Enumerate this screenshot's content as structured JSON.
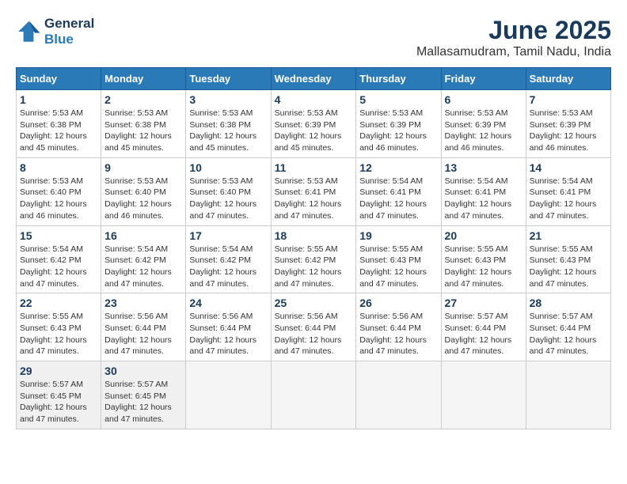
{
  "header": {
    "logo_line1": "General",
    "logo_line2": "Blue",
    "month": "June 2025",
    "location": "Mallasamudram, Tamil Nadu, India"
  },
  "weekdays": [
    "Sunday",
    "Monday",
    "Tuesday",
    "Wednesday",
    "Thursday",
    "Friday",
    "Saturday"
  ],
  "weeks": [
    [
      {
        "day": 1,
        "sunrise": "5:53 AM",
        "sunset": "6:38 PM",
        "daylight": "12 hours and 45 minutes."
      },
      {
        "day": 2,
        "sunrise": "5:53 AM",
        "sunset": "6:38 PM",
        "daylight": "12 hours and 45 minutes."
      },
      {
        "day": 3,
        "sunrise": "5:53 AM",
        "sunset": "6:38 PM",
        "daylight": "12 hours and 45 minutes."
      },
      {
        "day": 4,
        "sunrise": "5:53 AM",
        "sunset": "6:39 PM",
        "daylight": "12 hours and 45 minutes."
      },
      {
        "day": 5,
        "sunrise": "5:53 AM",
        "sunset": "6:39 PM",
        "daylight": "12 hours and 46 minutes."
      },
      {
        "day": 6,
        "sunrise": "5:53 AM",
        "sunset": "6:39 PM",
        "daylight": "12 hours and 46 minutes."
      },
      {
        "day": 7,
        "sunrise": "5:53 AM",
        "sunset": "6:39 PM",
        "daylight": "12 hours and 46 minutes."
      }
    ],
    [
      {
        "day": 8,
        "sunrise": "5:53 AM",
        "sunset": "6:40 PM",
        "daylight": "12 hours and 46 minutes."
      },
      {
        "day": 9,
        "sunrise": "5:53 AM",
        "sunset": "6:40 PM",
        "daylight": "12 hours and 46 minutes."
      },
      {
        "day": 10,
        "sunrise": "5:53 AM",
        "sunset": "6:40 PM",
        "daylight": "12 hours and 47 minutes."
      },
      {
        "day": 11,
        "sunrise": "5:53 AM",
        "sunset": "6:41 PM",
        "daylight": "12 hours and 47 minutes."
      },
      {
        "day": 12,
        "sunrise": "5:54 AM",
        "sunset": "6:41 PM",
        "daylight": "12 hours and 47 minutes."
      },
      {
        "day": 13,
        "sunrise": "5:54 AM",
        "sunset": "6:41 PM",
        "daylight": "12 hours and 47 minutes."
      },
      {
        "day": 14,
        "sunrise": "5:54 AM",
        "sunset": "6:41 PM",
        "daylight": "12 hours and 47 minutes."
      }
    ],
    [
      {
        "day": 15,
        "sunrise": "5:54 AM",
        "sunset": "6:42 PM",
        "daylight": "12 hours and 47 minutes."
      },
      {
        "day": 16,
        "sunrise": "5:54 AM",
        "sunset": "6:42 PM",
        "daylight": "12 hours and 47 minutes."
      },
      {
        "day": 17,
        "sunrise": "5:54 AM",
        "sunset": "6:42 PM",
        "daylight": "12 hours and 47 minutes."
      },
      {
        "day": 18,
        "sunrise": "5:55 AM",
        "sunset": "6:42 PM",
        "daylight": "12 hours and 47 minutes."
      },
      {
        "day": 19,
        "sunrise": "5:55 AM",
        "sunset": "6:43 PM",
        "daylight": "12 hours and 47 minutes."
      },
      {
        "day": 20,
        "sunrise": "5:55 AM",
        "sunset": "6:43 PM",
        "daylight": "12 hours and 47 minutes."
      },
      {
        "day": 21,
        "sunrise": "5:55 AM",
        "sunset": "6:43 PM",
        "daylight": "12 hours and 47 minutes."
      }
    ],
    [
      {
        "day": 22,
        "sunrise": "5:55 AM",
        "sunset": "6:43 PM",
        "daylight": "12 hours and 47 minutes."
      },
      {
        "day": 23,
        "sunrise": "5:56 AM",
        "sunset": "6:44 PM",
        "daylight": "12 hours and 47 minutes."
      },
      {
        "day": 24,
        "sunrise": "5:56 AM",
        "sunset": "6:44 PM",
        "daylight": "12 hours and 47 minutes."
      },
      {
        "day": 25,
        "sunrise": "5:56 AM",
        "sunset": "6:44 PM",
        "daylight": "12 hours and 47 minutes."
      },
      {
        "day": 26,
        "sunrise": "5:56 AM",
        "sunset": "6:44 PM",
        "daylight": "12 hours and 47 minutes."
      },
      {
        "day": 27,
        "sunrise": "5:57 AM",
        "sunset": "6:44 PM",
        "daylight": "12 hours and 47 minutes."
      },
      {
        "day": 28,
        "sunrise": "5:57 AM",
        "sunset": "6:44 PM",
        "daylight": "12 hours and 47 minutes."
      }
    ],
    [
      {
        "day": 29,
        "sunrise": "5:57 AM",
        "sunset": "6:45 PM",
        "daylight": "12 hours and 47 minutes."
      },
      {
        "day": 30,
        "sunrise": "5:57 AM",
        "sunset": "6:45 PM",
        "daylight": "12 hours and 47 minutes."
      },
      null,
      null,
      null,
      null,
      null
    ]
  ]
}
